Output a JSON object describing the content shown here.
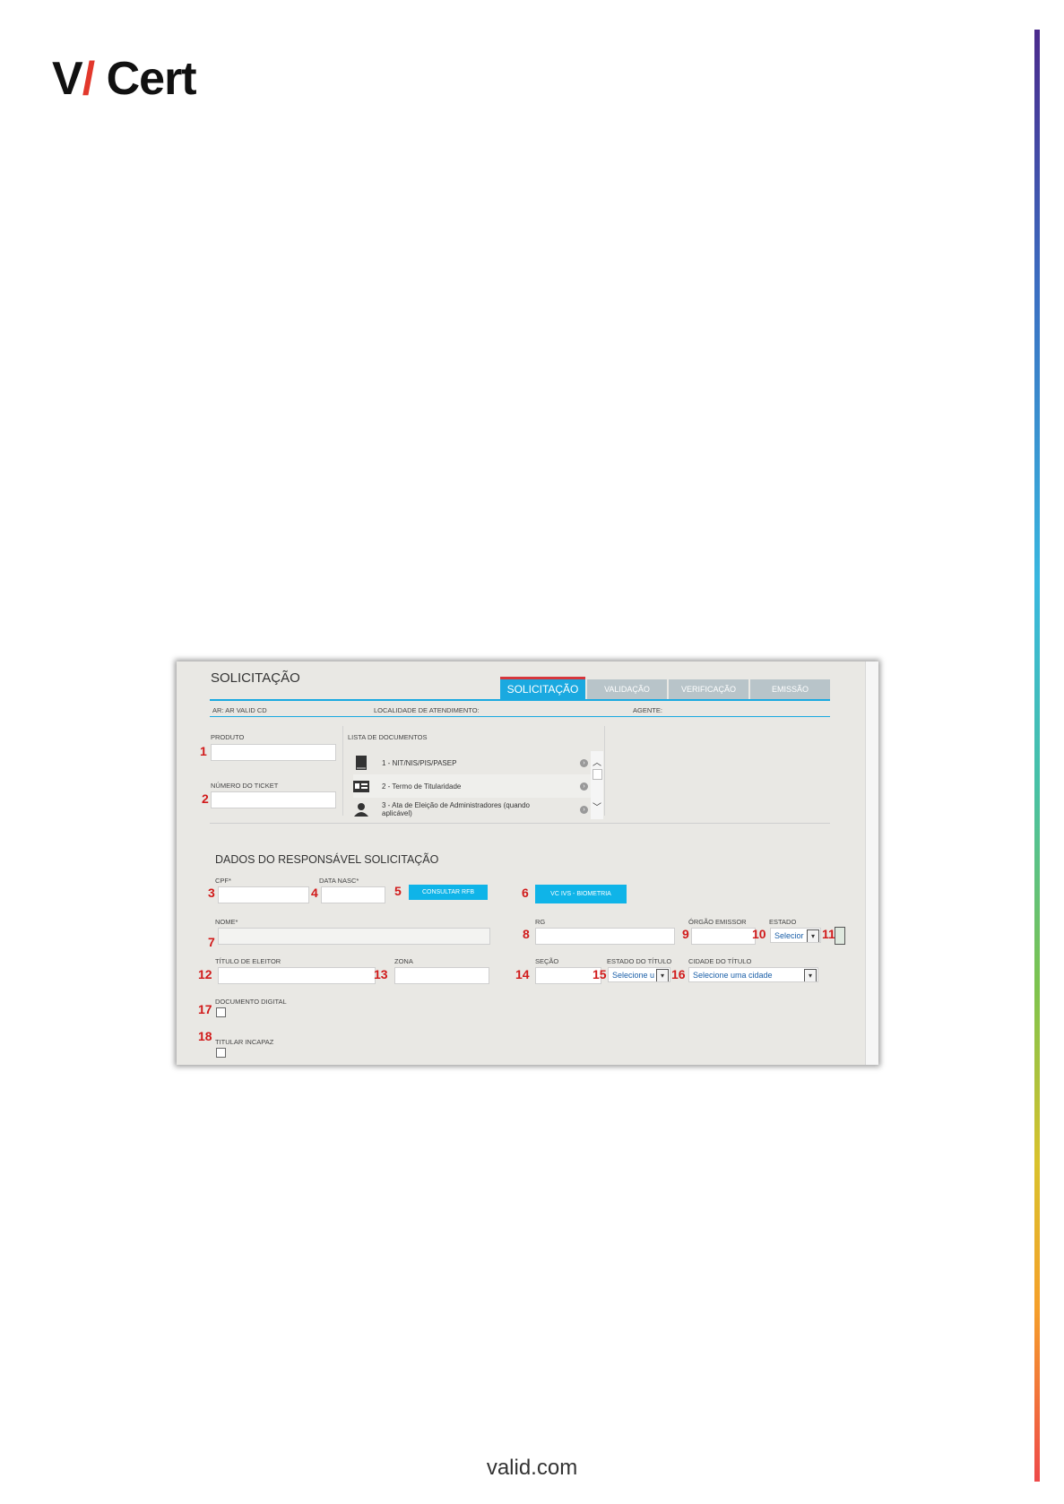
{
  "logo": {
    "v": "V",
    "slash": "/",
    "cert": "Cert"
  },
  "footer": {
    "text": "valid.com"
  },
  "screen": {
    "title": "SOLICITAÇÃO",
    "tabs": [
      {
        "label": "SOLICITAÇÃO",
        "active": true
      },
      {
        "label": "VALIDAÇÃO",
        "active": false
      },
      {
        "label": "VERIFICAÇÃO",
        "active": false
      },
      {
        "label": "EMISSÃO",
        "active": false
      }
    ],
    "info": {
      "ar_label": "AR:",
      "ar_value": "AR VALID CD",
      "localidade_label": "LOCALIDADE DE ATENDIMENTO:",
      "agente_label": "AGENTE:"
    },
    "produto_label": "PRODUTO",
    "ticket_label": "NÚMERO DO TICKET",
    "lista_label": "LISTA DE DOCUMENTOS",
    "documents": [
      {
        "label": "1 - NIT/NIS/PIS/PASEP",
        "icon": "book-icon"
      },
      {
        "label": "2 - Termo de Titularidade",
        "icon": "id-card-icon"
      },
      {
        "label": "3 - Ata de Eleição de Administradores (quando aplicável)",
        "icon": "person-icon"
      }
    ],
    "section_title": "DADOS DO RESPONSÁVEL SOLICITAÇÃO",
    "cpf_label": "CPF*",
    "data_nasc_label": "DATA NASC*",
    "consultar_button": "CONSULTAR RFB",
    "biometria_button": "VC IVS - BIOMETRIA",
    "nome_label": "NOME*",
    "rg_label": "RG",
    "orgao_label": "ÓRGÃO EMISSOR",
    "estado_label": "ESTADO",
    "estado_select": "Selecior",
    "titulo_label": "TÍTULO DE ELEITOR",
    "zona_label": "ZONA",
    "secao_label": "SEÇÃO",
    "estado_titulo_label": "ESTADO DO TÍTULO",
    "estado_titulo_select": "Selecione u",
    "cidade_titulo_label": "CIDADE DO TÍTULO",
    "cidade_titulo_select": "Selecione uma cidade",
    "doc_digital_label": "DOCUMENTO DIGITAL",
    "titular_incapaz_label": "TITULAR INCAPAZ",
    "markers": [
      "1",
      "2",
      "3",
      "4",
      "5",
      "6",
      "7",
      "8",
      "9",
      "10",
      "11",
      "12",
      "13",
      "14",
      "15",
      "16",
      "17",
      "18"
    ]
  }
}
